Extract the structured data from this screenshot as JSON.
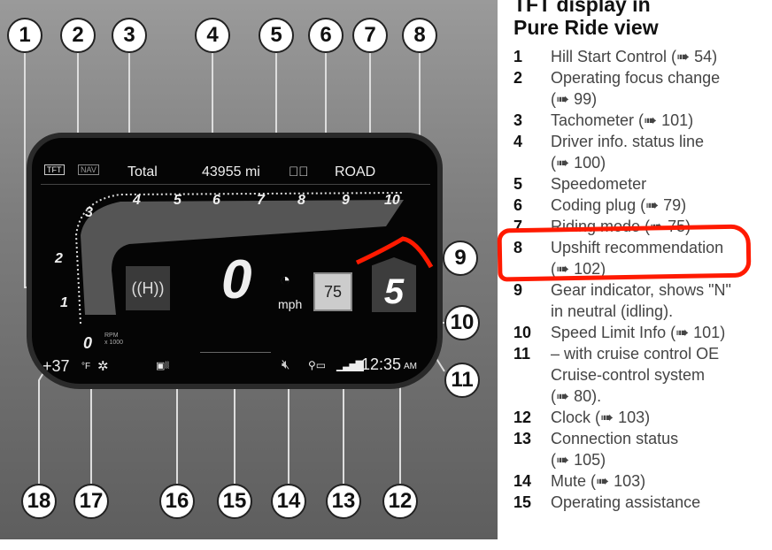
{
  "display": {
    "status_line": {
      "mode_icons": [
        "TFT",
        "NAV"
      ],
      "total_label": "Total",
      "odometer": "43955 mi",
      "riding_mode": "ROAD"
    },
    "tacho": {
      "ticks": [
        "0",
        "1",
        "2",
        "3",
        "4",
        "5",
        "6",
        "7",
        "8",
        "9",
        "10"
      ],
      "unit_top": "RPM",
      "unit_bottom": "x 1000"
    },
    "speed": "0",
    "speed_unit": "mph",
    "speed_limit": "75",
    "gear": "5",
    "temperature": "+37",
    "temp_unit": "°F",
    "clock": "12:35",
    "clock_suffix": "AM",
    "accent_color": "#ff1a00"
  },
  "callouts": [
    "1",
    "2",
    "3",
    "4",
    "5",
    "6",
    "7",
    "8",
    "9",
    "10",
    "11",
    "12",
    "13",
    "14",
    "15",
    "16",
    "17",
    "18"
  ],
  "legend": {
    "title_line1": "TFT display in",
    "title_line2": "Pure Ride view",
    "items": [
      {
        "num": "1",
        "text": "Hill Start Control  (➠ 54)"
      },
      {
        "num": "2",
        "text": "Operating focus change",
        "ref": "(➠ 99)"
      },
      {
        "num": "3",
        "text": "Tachometer (➠ 101)"
      },
      {
        "num": "4",
        "text": "Driver info. status line",
        "ref": "(➠ 100)"
      },
      {
        "num": "5",
        "text": "Speedometer"
      },
      {
        "num": "6",
        "text": "Coding plug  (➠ 79)"
      },
      {
        "num": "7",
        "text": "Riding mode  (➠ 75)"
      },
      {
        "num": "8",
        "text": "Upshift recommendation",
        "ref": "(➠ 102)"
      },
      {
        "num": "9",
        "text": "Gear indicator, shows \"N\"",
        "ref": "in neutral (idling)."
      },
      {
        "num": "10",
        "text": "Speed Limit Info  (➠ 101)"
      },
      {
        "num": "11",
        "text": "– with cruise control OE",
        "ref": "Cruise-control system",
        "ref2": "(➠ 80)."
      },
      {
        "num": "12",
        "text": "Clock  (➠ 103)"
      },
      {
        "num": "13",
        "text": "Connection status",
        "ref": "(➠ 105)"
      },
      {
        "num": "14",
        "text": "Mute  (➠ 103)"
      },
      {
        "num": "15",
        "text": "Operating assistance"
      }
    ]
  }
}
